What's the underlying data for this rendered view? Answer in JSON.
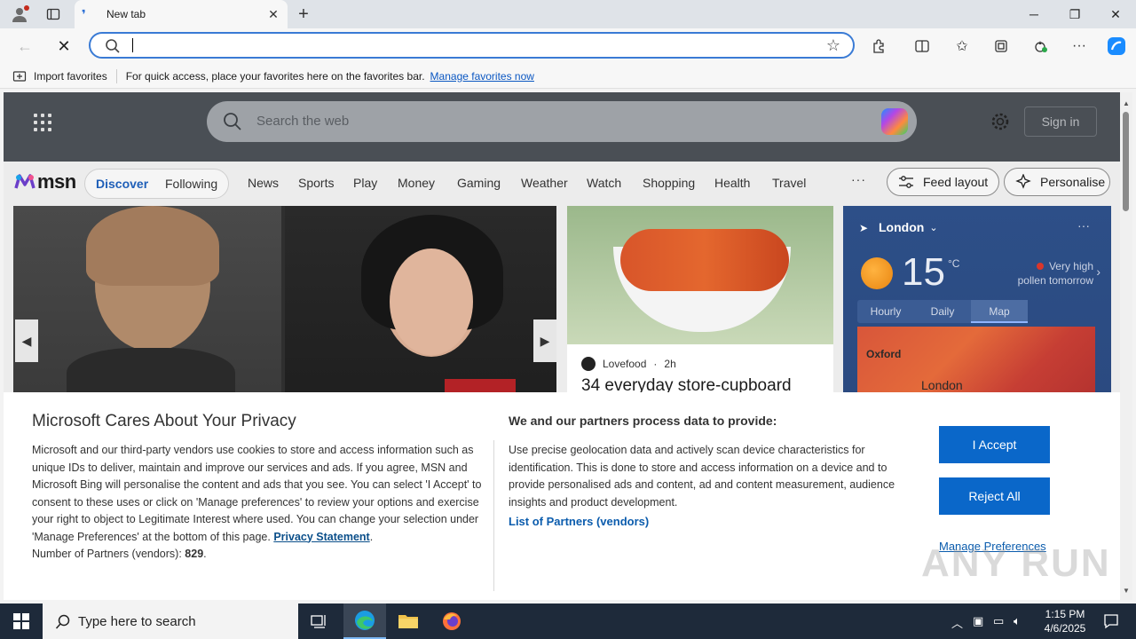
{
  "browser": {
    "tab_title": "New tab",
    "address_value": "",
    "favorites_bar": {
      "import_label": "Import favorites",
      "hint": "For quick access, place your favorites here on the favorites bar.",
      "manage_link": "Manage favorites now"
    }
  },
  "msn": {
    "search_placeholder": "Search the web",
    "sign_in": "Sign in",
    "logo_text": "msn",
    "feed_tabs": [
      "Discover",
      "Following"
    ],
    "nav": [
      "News",
      "Sports",
      "Play",
      "Money",
      "Gaming",
      "Weather",
      "Watch",
      "Shopping",
      "Health",
      "Travel"
    ],
    "more": "···",
    "feed_layout": "Feed layout",
    "personalise": "Personalise",
    "card": {
      "source": "Lovefood",
      "age": "2h",
      "headline": "34 everyday store-cupboard"
    },
    "weather": {
      "city": "London",
      "temp": "15",
      "unit": "°C",
      "pollen_line1": "Very high",
      "pollen_line2": "pollen tomorrow",
      "tabs": [
        "Hourly",
        "Daily",
        "Map"
      ],
      "map_labels": [
        "Oxford",
        "London"
      ]
    }
  },
  "privacy": {
    "title": "Microsoft Cares About Your Privacy",
    "body": "Microsoft and our third-party vendors use cookies to store and access information such as unique IDs to deliver, maintain and improve our services and ads. If you agree, MSN and Microsoft Bing will personalise the content and ads that you see. You can select 'I Accept' to consent to these uses or click on 'Manage preferences' to review your options and exercise your right to object to Legitimate Interest where used.  You can change your selection under 'Manage Preferences' at the bottom of this page.",
    "privacy_link": "Privacy Statement",
    "partners_label": "Number of Partners (vendors):",
    "partners_count": "829",
    "right_heading": "We and our partners process data to provide:",
    "right_body": "Use precise geolocation data and actively scan device characteristics for identification. This is done to store and access information on a device and to provide personalised ads and content, ad and content measurement, audience insights and product development.",
    "vendors_link": "List of Partners (vendors)",
    "accept": "I Accept",
    "reject": "Reject All",
    "manage": "Manage Preferences"
  },
  "watermark": "ANY RUN",
  "taskbar": {
    "search_placeholder": "Type here to search",
    "time": "1:15 PM",
    "date": "4/6/2025"
  }
}
